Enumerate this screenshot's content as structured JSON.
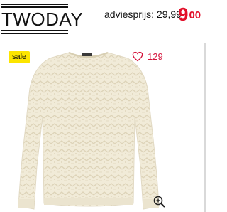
{
  "header": {
    "logo_text": "TWODAY",
    "advice_label": "adviesprijs: 29,99",
    "price_main": "9",
    "price_cents": "00",
    "price_color": "#e2102a"
  },
  "product": {
    "badge": "sale",
    "favorites_count": "129",
    "image_name": "cream knit sweater",
    "image_color": "#f0ead7"
  },
  "icons": {
    "favorite": "heart-outline-icon",
    "zoom": "magnifier-plus-icon"
  }
}
